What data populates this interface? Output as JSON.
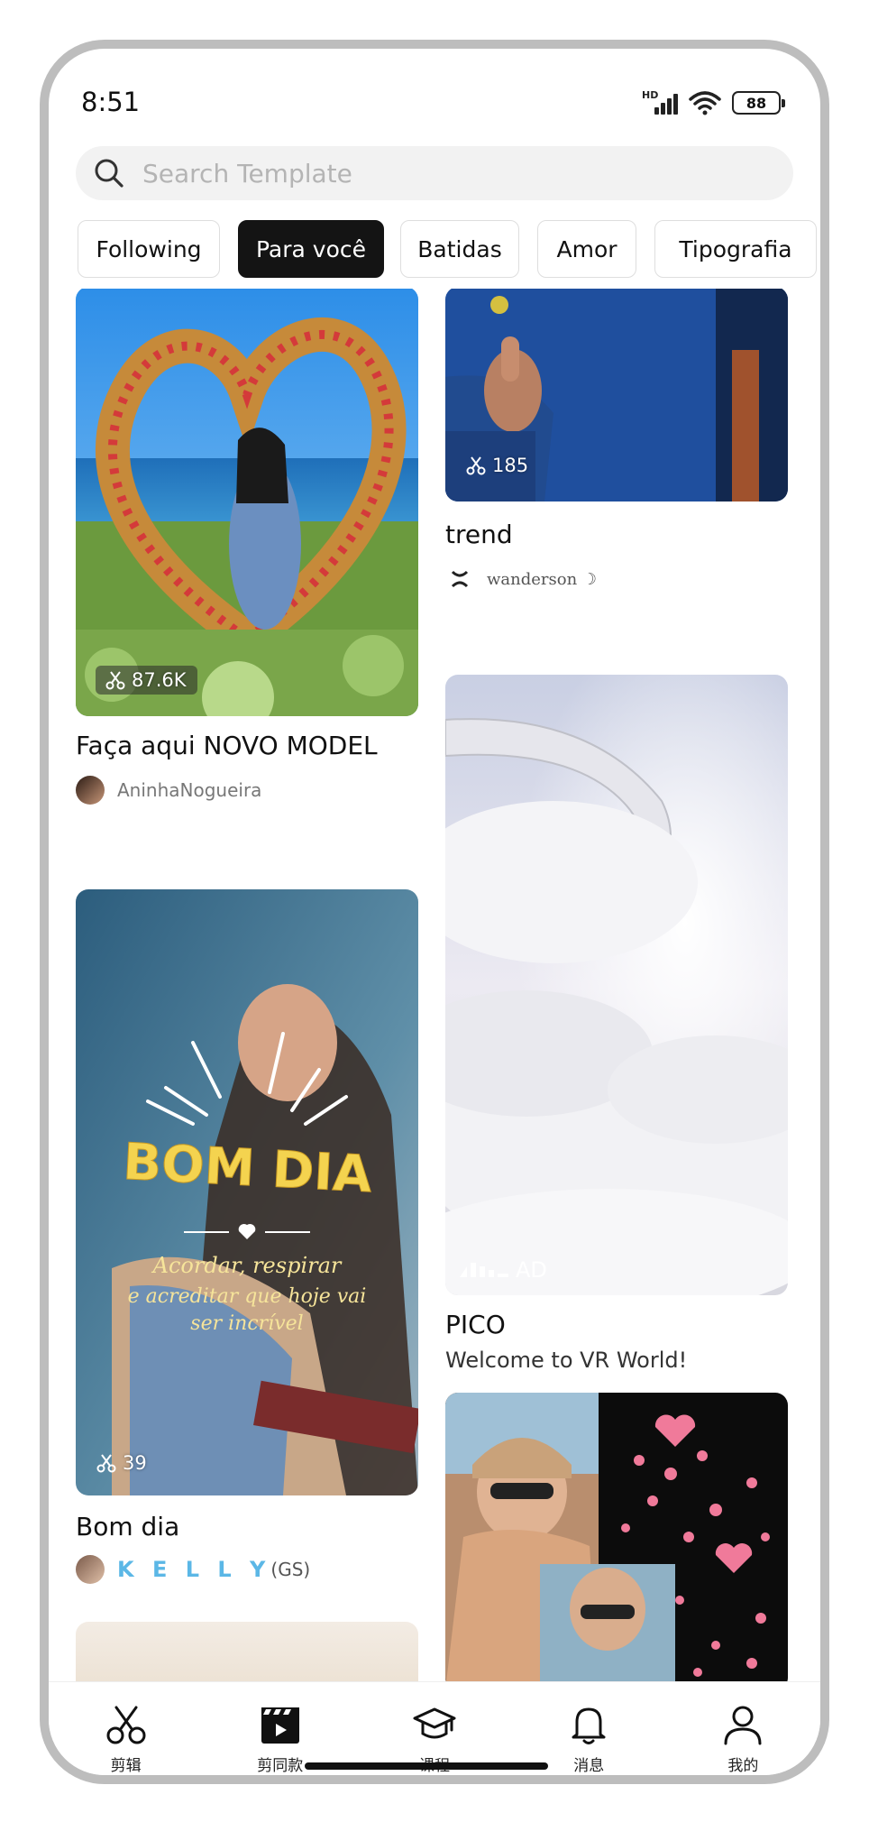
{
  "status_bar": {
    "time": "8:51",
    "signal_label": "HD",
    "battery": "88"
  },
  "search": {
    "placeholder": "Search Template"
  },
  "tabs": [
    {
      "label": "Following",
      "active": false
    },
    {
      "label": "Para você",
      "active": true
    },
    {
      "label": "Batidas",
      "active": false
    },
    {
      "label": "Amor",
      "active": false
    },
    {
      "label": "Tipografia",
      "active": false
    }
  ],
  "feed": {
    "left": [
      {
        "title": "Faça aqui NOVO MODEL",
        "author": "AninhaNogueira",
        "uses": "87.6K"
      },
      {
        "title": "Bom dia",
        "author": "K E L L Y",
        "author_suffix": "(GS)",
        "uses": "39",
        "overlay_heading": "BOM DIA",
        "overlay_line1": "Acordar, respirar",
        "overlay_line2": "e acreditar que hoje vai",
        "overlay_line3": "ser incrível"
      }
    ],
    "right": [
      {
        "title": "trend",
        "author": "wanderson ☽",
        "uses": "185"
      },
      {
        "title": "PICO",
        "subtitle": "Welcome to VR World!",
        "badge": "AD"
      }
    ]
  },
  "bottom_nav": [
    {
      "label": "剪辑",
      "icon": "scissors-icon"
    },
    {
      "label": "剪同款",
      "icon": "clapperboard-icon"
    },
    {
      "label": "课程",
      "icon": "graduation-cap-icon"
    },
    {
      "label": "消息",
      "icon": "bell-icon"
    },
    {
      "label": "我的",
      "icon": "user-icon"
    }
  ]
}
